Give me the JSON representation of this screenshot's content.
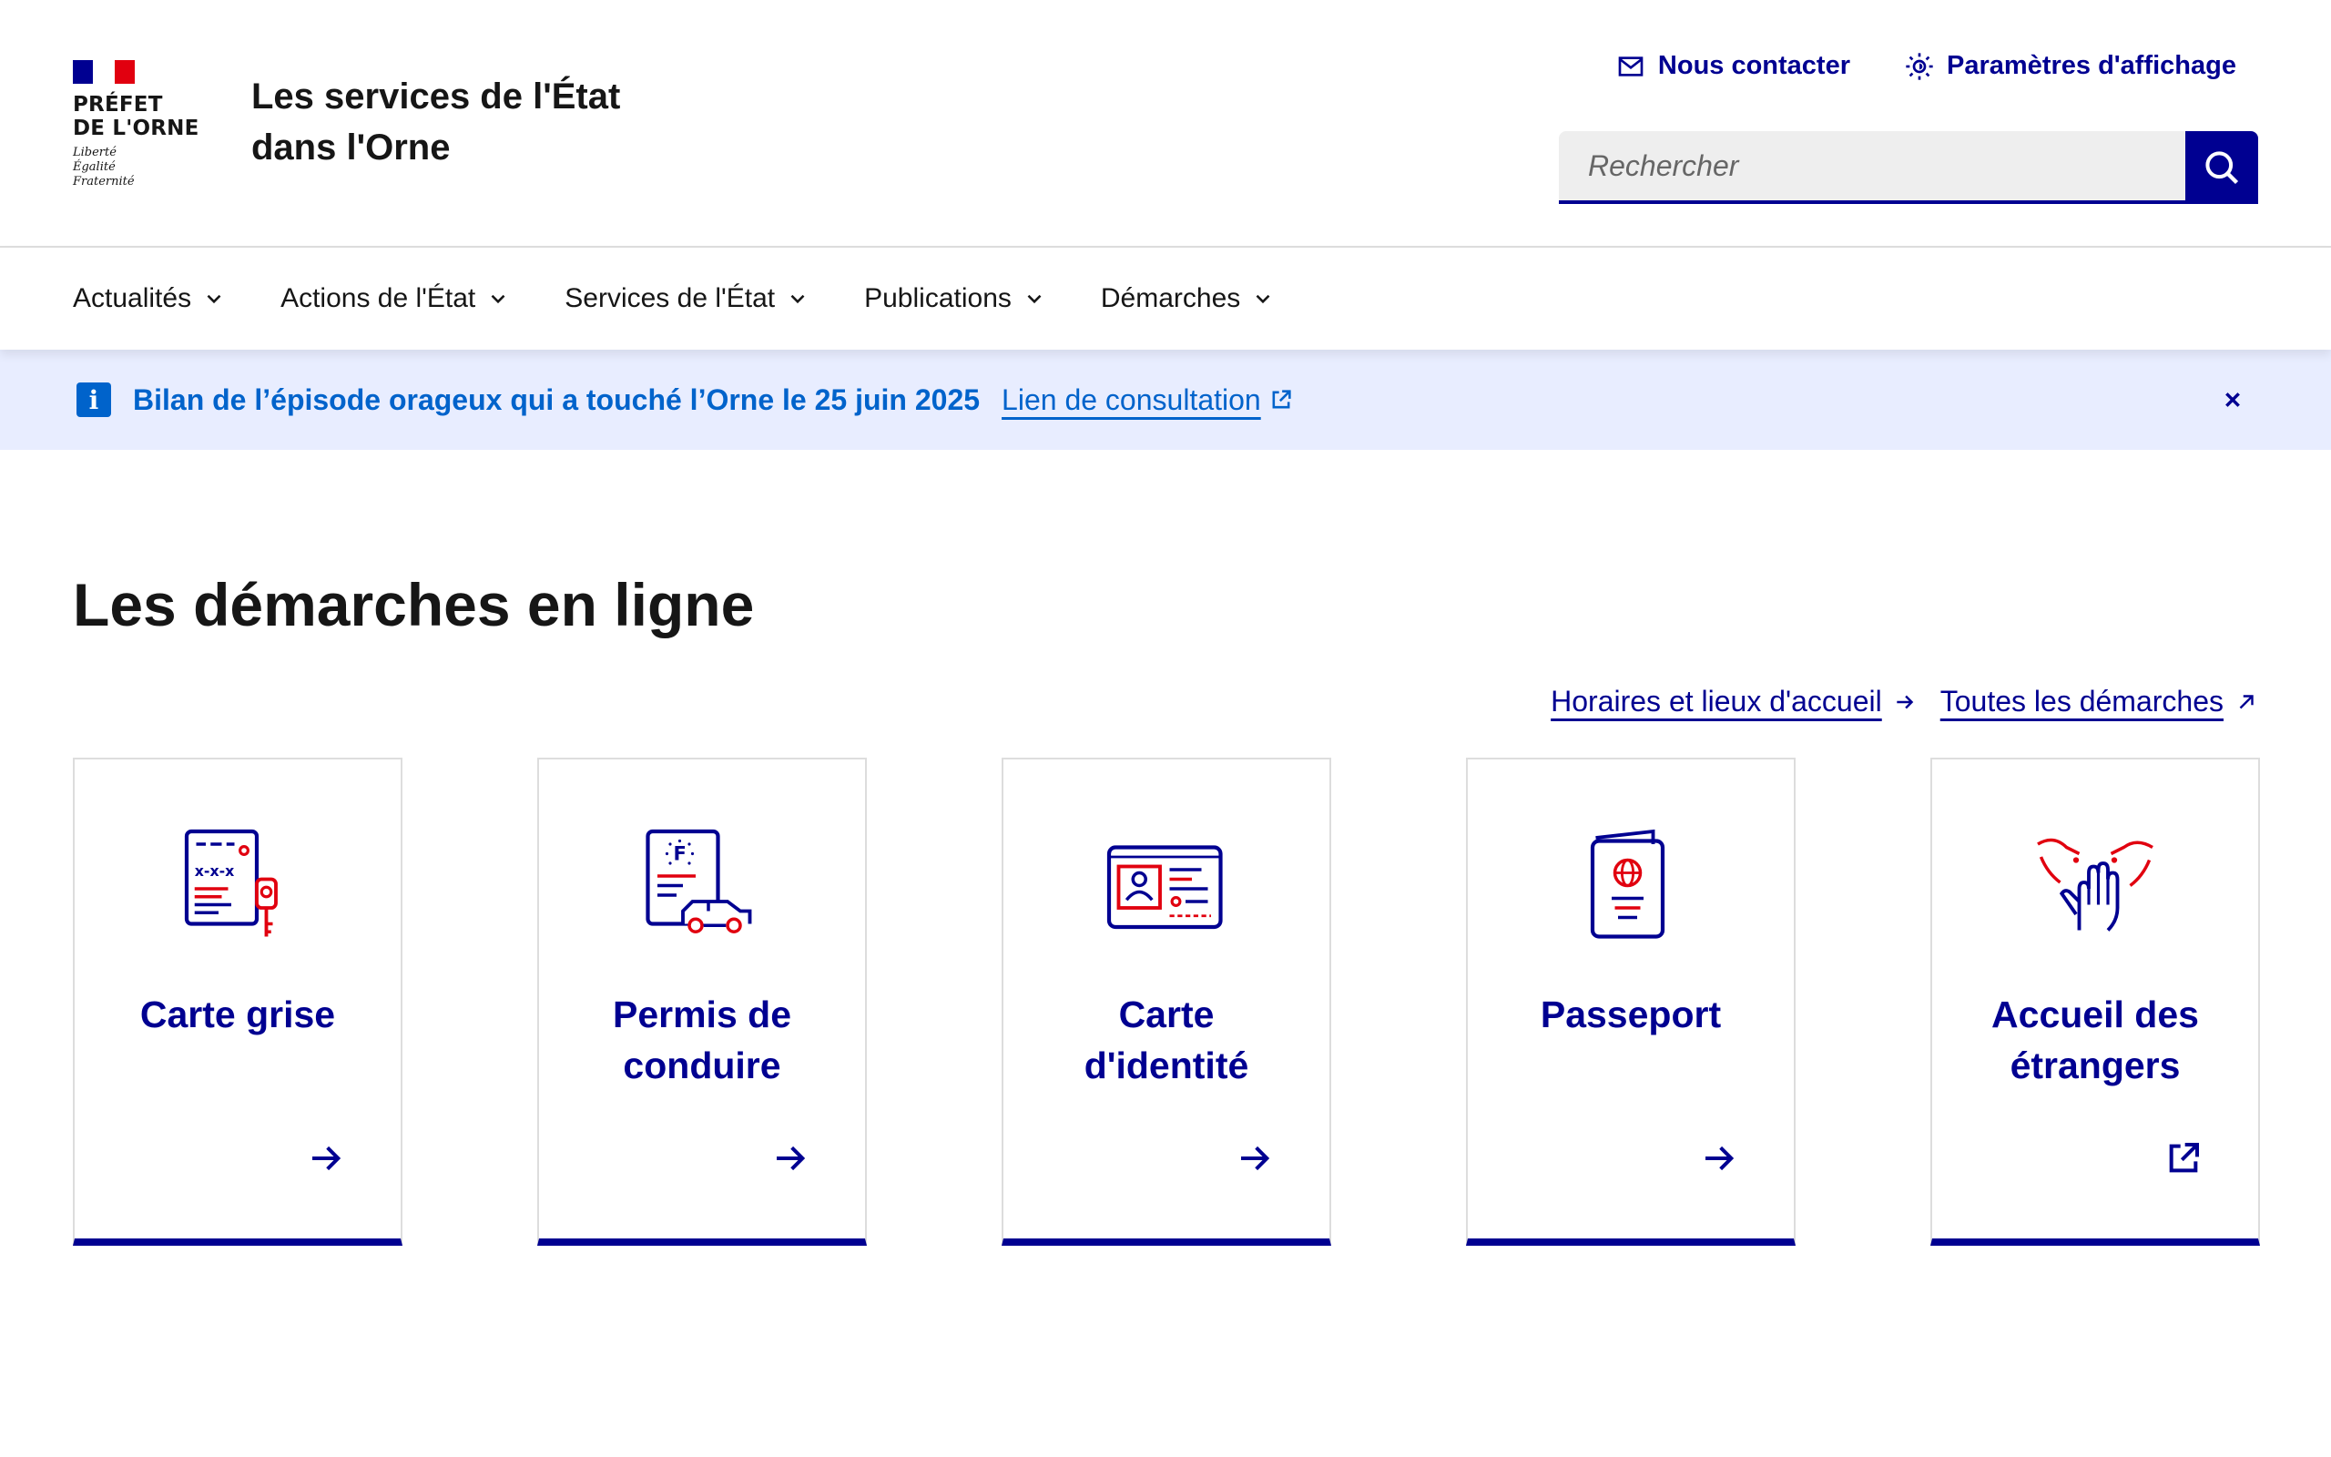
{
  "header": {
    "marianne_lines": [
      "PRÉFET",
      "DE L'ORNE"
    ],
    "motto": [
      "Liberté",
      "Égalité",
      "Fraternité"
    ],
    "site_title_line1": "Les services de l'État",
    "site_title_line2": "dans l'Orne",
    "tools": {
      "contact": "Nous contacter",
      "display_settings": "Paramètres d'affichage"
    },
    "search": {
      "placeholder": "Rechercher"
    }
  },
  "nav": {
    "items": [
      {
        "label": "Actualités"
      },
      {
        "label": "Actions de l'État"
      },
      {
        "label": "Services de l'État"
      },
      {
        "label": "Publications"
      },
      {
        "label": "Démarches"
      }
    ]
  },
  "notice": {
    "title": "Bilan de l’épisode orageux qui a touché l’Orne le 25 juin 2025",
    "link": "Lien de consultation"
  },
  "main": {
    "title": "Les démarches en ligne",
    "links": {
      "hours": "Horaires et lieux d'accueil",
      "all": "Toutes les démarches"
    },
    "tiles": [
      {
        "line1": "Carte grise",
        "line2": "",
        "icon": "vehicle-registration-icon",
        "arrow": "arrow-right-icon"
      },
      {
        "line1": "Permis de",
        "line2": "conduire",
        "icon": "driving-licence-icon",
        "arrow": "arrow-right-icon"
      },
      {
        "line1": "Carte",
        "line2": "d'identité",
        "icon": "id-card-icon",
        "arrow": "arrow-right-icon"
      },
      {
        "line1": "Passeport",
        "line2": "",
        "icon": "passport-icon",
        "arrow": "arrow-right-icon"
      },
      {
        "line1": "Accueil des",
        "line2": "étrangers",
        "icon": "welcome-hands-icon",
        "arrow": "external-link-icon"
      }
    ]
  },
  "colors": {
    "primary": "#000091",
    "accent_red": "#e1000f",
    "info_blue": "#0063cb",
    "notice_bg": "#e8edff",
    "text": "#161616",
    "border": "#dddddd"
  }
}
